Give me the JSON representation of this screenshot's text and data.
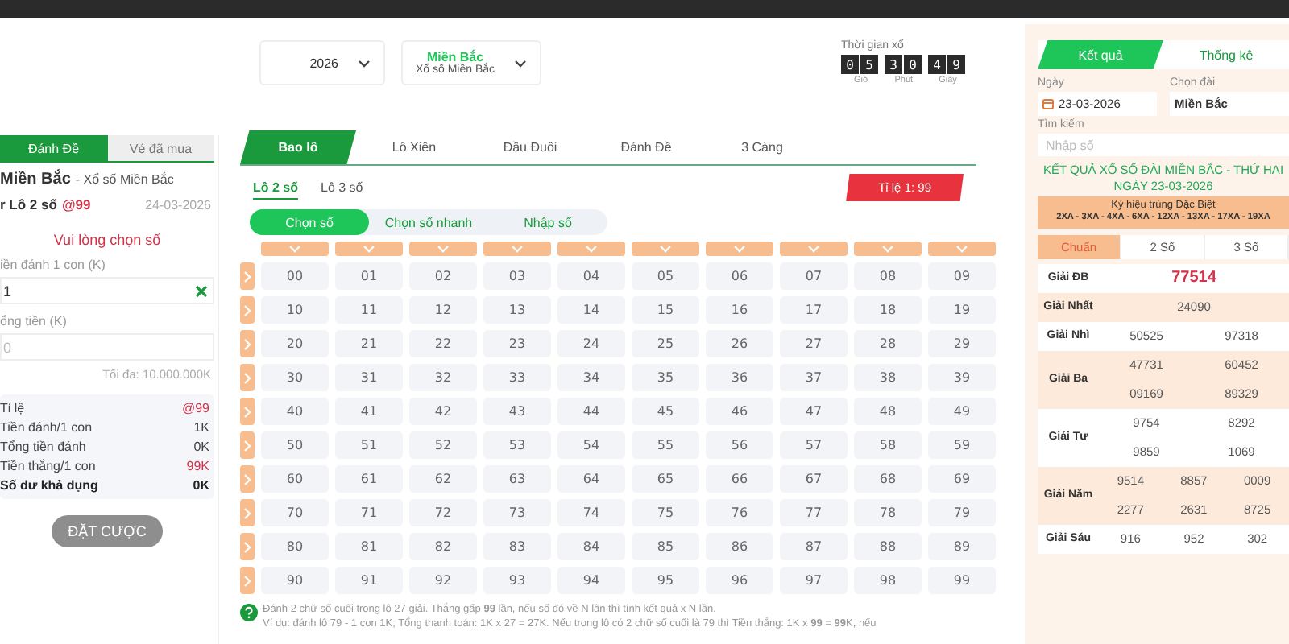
{
  "header": {
    "date_select": "2026",
    "region_select": {
      "title": "Miền Bắc",
      "subtitle": "Xổ số Miền Bắc"
    },
    "countdown": {
      "label": "Thời gian xổ",
      "digits": [
        "0",
        "5",
        "3",
        "0",
        "4",
        "9"
      ],
      "units": [
        "Giờ",
        "Phút",
        "Giây"
      ]
    }
  },
  "left_panel": {
    "tabs": [
      {
        "label": "Đánh Đề",
        "selected": true
      },
      {
        "label": "Vé đã mua",
        "selected": false
      }
    ],
    "region": "Miền Bắc",
    "region_sub": "- Xổ số Miền Bắc",
    "bet_type": "r Lô 2 số",
    "bet_rate": "@99",
    "date": "24-03-2026",
    "prompt": "Vui lòng chọn số",
    "stake_label": "iền đánh 1 con (K)",
    "stake_value": "1",
    "total_label": "ổng tiền (K)",
    "total_placeholder": "0",
    "max_note": "Tối đa: 10.000.000K",
    "summary": [
      {
        "label": "Tỉ lệ",
        "value": "@99",
        "kind": "highlight"
      },
      {
        "label": "Tiền đánh/1 con",
        "value": "1K",
        "kind": "normal"
      },
      {
        "label": "Tổng tiền đánh",
        "value": "0K",
        "kind": "normal"
      },
      {
        "label": "Tiền thắng/1 con",
        "value": "99K",
        "kind": "highlight"
      },
      {
        "label": "Số dư khả dụng",
        "value": "0K",
        "kind": "strong"
      }
    ],
    "submit": "ĐẶT CƯỢC"
  },
  "bet_tabs": [
    {
      "label": "Bao lô",
      "selected": true
    },
    {
      "label": "Lô Xiên",
      "selected": false
    },
    {
      "label": "Đầu Đuôi",
      "selected": false
    },
    {
      "label": "Đánh Đề",
      "selected": false
    },
    {
      "label": "3 Càng",
      "selected": false
    }
  ],
  "sub_tabs": [
    {
      "label": "Lô 2 số",
      "selected": true
    },
    {
      "label": "Lô 3 số",
      "selected": false
    }
  ],
  "rate_badge": "Tỉ lệ 1: 99",
  "modes": [
    {
      "label": "Chọn số",
      "selected": true
    },
    {
      "label": "Chọn số nhanh",
      "selected": false
    },
    {
      "label": "Nhập số",
      "selected": false
    }
  ],
  "number_grid": {
    "rows": [
      [
        "00",
        "01",
        "02",
        "03",
        "04",
        "05",
        "06",
        "07",
        "08",
        "09"
      ],
      [
        "10",
        "11",
        "12",
        "13",
        "14",
        "15",
        "16",
        "17",
        "18",
        "19"
      ],
      [
        "20",
        "21",
        "22",
        "23",
        "24",
        "25",
        "26",
        "27",
        "28",
        "29"
      ],
      [
        "30",
        "31",
        "32",
        "33",
        "34",
        "35",
        "36",
        "37",
        "38",
        "39"
      ],
      [
        "40",
        "41",
        "42",
        "43",
        "44",
        "45",
        "46",
        "47",
        "48",
        "49"
      ],
      [
        "50",
        "51",
        "52",
        "53",
        "54",
        "55",
        "56",
        "57",
        "58",
        "59"
      ],
      [
        "60",
        "61",
        "62",
        "63",
        "64",
        "65",
        "66",
        "67",
        "68",
        "69"
      ],
      [
        "70",
        "71",
        "72",
        "73",
        "74",
        "75",
        "76",
        "77",
        "78",
        "79"
      ],
      [
        "80",
        "81",
        "82",
        "83",
        "84",
        "85",
        "86",
        "87",
        "88",
        "89"
      ],
      [
        "90",
        "91",
        "92",
        "93",
        "94",
        "95",
        "96",
        "97",
        "98",
        "99"
      ]
    ]
  },
  "help": {
    "line1": "Đánh 2 chữ số cuối trong lô 27 giải. Thắng gấp **99** lần, nếu số đó về N lần thì tính kết quả x N lần.",
    "line2": "Ví dụ: đánh lô 79 - 1 con 1K, Tổng thanh toán: 1K x 27 = 27K. Nếu trong lô có 2 chữ số cuối là 79 thì Tiền thắng: 1K x **99** = **99**K, nếu"
  },
  "results": {
    "tabs": [
      {
        "label": "Kết quả",
        "selected": true
      },
      {
        "label": "Thống kê",
        "selected": false
      }
    ],
    "date_label": "Ngày",
    "date_value": "23-03-2026",
    "station_label": "Chọn đài",
    "station_value": "Miền Bắc",
    "search_label": "Tìm kiếm",
    "search_placeholder": "Nhập số",
    "title": "KẾT QUẢ XỔ SỐ ĐÀI MIỀN BẮC - THỨ HAI NGÀY 23-03-2026",
    "special_codes_label": "Ký hiệu trúng Đặc Biệt",
    "special_codes": "2XA - 3XA - 4XA - 6XA - 12XA - 13XA - 17XA - 19XA",
    "modes": [
      {
        "label": "Chuẩn",
        "selected": true
      },
      {
        "label": "2 Số",
        "selected": false
      },
      {
        "label": "3 Số",
        "selected": false
      }
    ],
    "prizes": [
      {
        "label": "Giải ĐB",
        "kind": "special",
        "lines": [
          [
            "77514"
          ]
        ]
      },
      {
        "label": "Giải Nhất",
        "kind": "normal",
        "lines": [
          [
            "24090"
          ]
        ]
      },
      {
        "label": "Giải Nhì",
        "kind": "normal",
        "lines": [
          [
            "50525",
            "97318"
          ]
        ]
      },
      {
        "label": "Giải Ba",
        "kind": "normal",
        "lines": [
          [
            "47731",
            "60452"
          ],
          [
            "09169",
            "89329"
          ]
        ]
      },
      {
        "label": "Giải Tư",
        "kind": "normal",
        "lines": [
          [
            "9754",
            "8292"
          ],
          [
            "9859",
            "1069"
          ]
        ]
      },
      {
        "label": "Giải Năm",
        "kind": "normal",
        "lines": [
          [
            "9514",
            "8857",
            "0009"
          ],
          [
            "2277",
            "2631",
            "8725"
          ]
        ]
      },
      {
        "label": "Giải Sáu",
        "kind": "normal",
        "lines": [
          [
            "916",
            "952",
            "302"
          ]
        ]
      }
    ]
  }
}
